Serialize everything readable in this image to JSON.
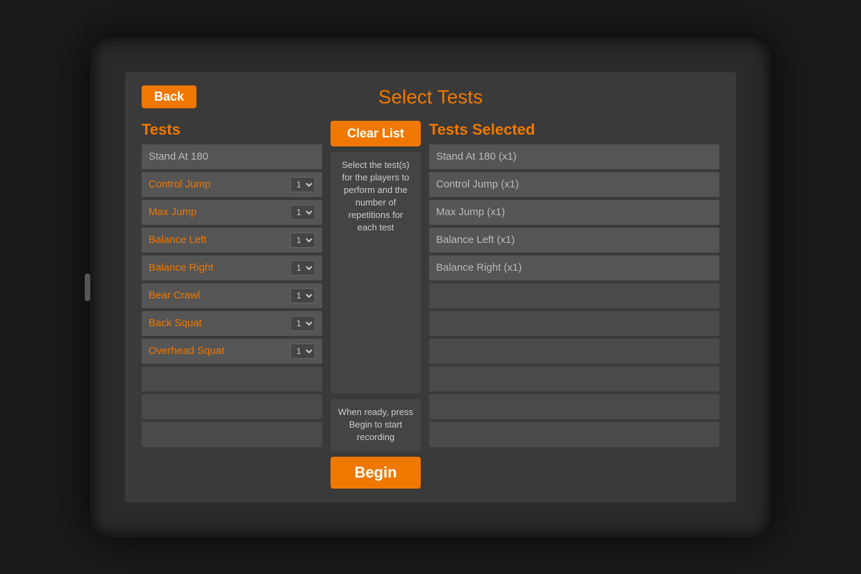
{
  "header": {
    "back_label": "Back",
    "title": "Select Tests"
  },
  "tests_column": {
    "title": "Tests",
    "items": [
      {
        "label": "Stand At 180",
        "has_counter": false
      },
      {
        "label": "Control Jump",
        "has_counter": true,
        "counter_val": "1"
      },
      {
        "label": "Max Jump",
        "has_counter": true,
        "counter_val": "1"
      },
      {
        "label": "Balance Left",
        "has_counter": true,
        "counter_val": "1"
      },
      {
        "label": "Balance Right",
        "has_counter": true,
        "counter_val": "1"
      },
      {
        "label": "Bear Crawl",
        "has_counter": true,
        "counter_val": "1"
      },
      {
        "label": "Back Squat",
        "has_counter": true,
        "counter_val": "1"
      },
      {
        "label": "Overhead Squat",
        "has_counter": true,
        "counter_val": "1"
      },
      {
        "label": "",
        "has_counter": false
      },
      {
        "label": "",
        "has_counter": false
      },
      {
        "label": "",
        "has_counter": false
      }
    ]
  },
  "middle": {
    "clear_list_label": "Clear List",
    "instructions": "Select the test(s) for the players to perform and the number of repetitions for each test",
    "when_ready": "When ready, press Begin to start recording",
    "begin_label": "Begin"
  },
  "selected_column": {
    "title": "Tests Selected",
    "items": [
      {
        "label": "Stand At 180 (x1)"
      },
      {
        "label": "Control Jump (x1)"
      },
      {
        "label": "Max Jump (x1)"
      },
      {
        "label": "Balance Left (x1)"
      },
      {
        "label": "Balance Right (x1)"
      },
      {
        "label": ""
      },
      {
        "label": ""
      },
      {
        "label": ""
      },
      {
        "label": ""
      },
      {
        "label": ""
      },
      {
        "label": ""
      }
    ]
  }
}
